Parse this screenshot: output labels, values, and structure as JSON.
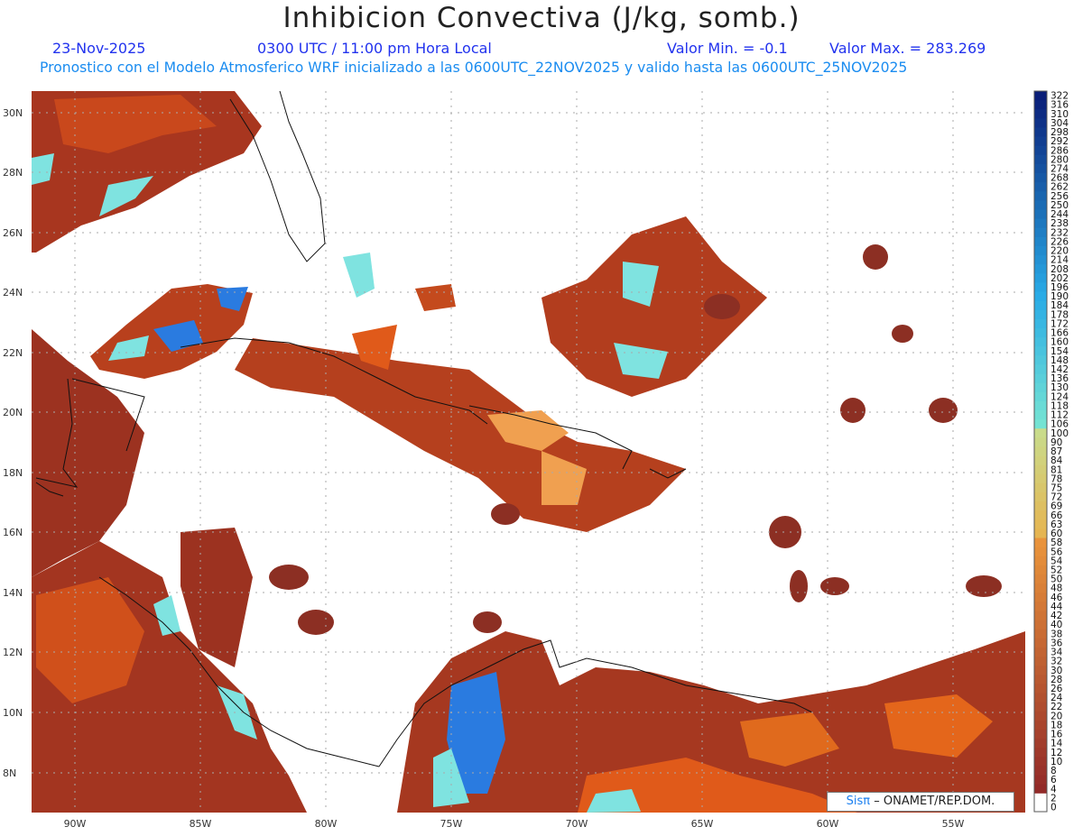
{
  "header": {
    "title": "Inhibicion Convectiva (J/kg, somb.)",
    "date": "23-Nov-2025",
    "time": "0300 UTC / 11:00 pm Hora Local",
    "valmin": "Valor Min. = -0.1",
    "valmax": "Valor Max. = 283.269",
    "subtitle": "Pronostico con el Modelo Atmosferico WRF inicializado a las 0600UTC_22NOV2025 y valido hasta las  0600UTC_25NOV2025"
  },
  "credit": {
    "sis": "Sisπ",
    "org": "– ONAMET/REP.DOM."
  },
  "axes": {
    "x_ticks": [
      "90W",
      "85W",
      "80W",
      "75W",
      "70W",
      "65W",
      "60W",
      "55W"
    ],
    "y_ticks": [
      "30N",
      "28N",
      "26N",
      "24N",
      "22N",
      "20N",
      "18N",
      "16N",
      "14N",
      "12N",
      "10N",
      "8N"
    ]
  },
  "colorbar": {
    "labels": [
      "322",
      "316",
      "310",
      "304",
      "298",
      "292",
      "286",
      "280",
      "274",
      "268",
      "262",
      "256",
      "250",
      "244",
      "238",
      "232",
      "226",
      "220",
      "214",
      "208",
      "202",
      "196",
      "190",
      "184",
      "178",
      "172",
      "166",
      "160",
      "154",
      "148",
      "142",
      "136",
      "130",
      "124",
      "118",
      "112",
      "106",
      "100",
      "90",
      "87",
      "84",
      "81",
      "78",
      "75",
      "72",
      "69",
      "66",
      "63",
      "60",
      "58",
      "56",
      "54",
      "52",
      "50",
      "48",
      "46",
      "44",
      "42",
      "40",
      "38",
      "36",
      "34",
      "32",
      "30",
      "28",
      "26",
      "24",
      "22",
      "20",
      "18",
      "16",
      "14",
      "12",
      "10",
      "8",
      "6",
      "4",
      "2",
      "0"
    ]
  },
  "colors": {
    "field_low": "#8c2f23",
    "field_mid": "#e0561a",
    "field_high": "#f0a050",
    "field_cyan": "#7fe3e0",
    "field_blue": "#2a7be0",
    "bg": "#ffffff"
  }
}
